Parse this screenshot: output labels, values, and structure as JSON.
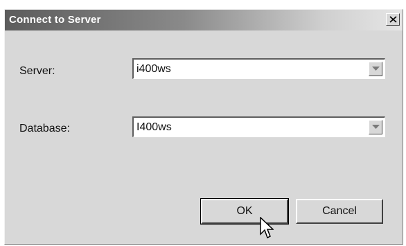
{
  "window": {
    "title": "Connect to Server",
    "close_label": "X"
  },
  "form": {
    "server_label": "Server:",
    "server_value": "i400ws",
    "database_label": "Database:",
    "database_value": "I400ws"
  },
  "buttons": {
    "ok_label": "OK",
    "cancel_label": "Cancel"
  },
  "icons": {
    "close": "close-icon",
    "dropdown": "chevron-down-icon",
    "cursor": "mouse-pointer-icon"
  }
}
